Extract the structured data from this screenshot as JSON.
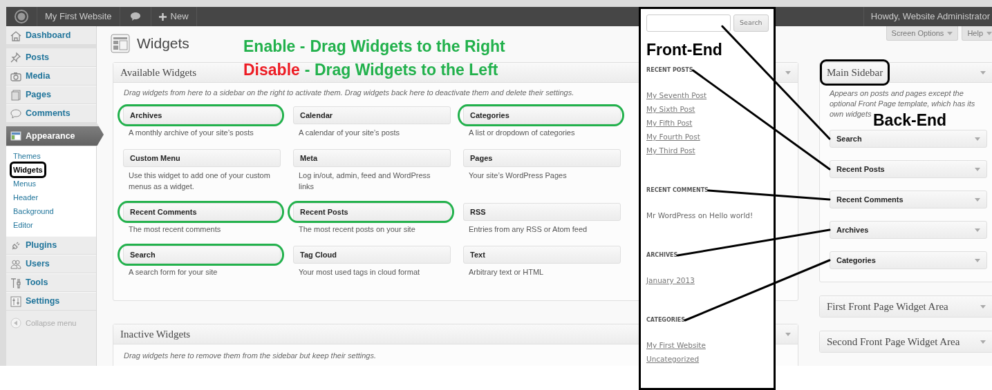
{
  "admin_bar": {
    "site_name": "My First Website",
    "new_label": "New",
    "greeting": "Howdy, Website Administrator"
  },
  "menu": [
    {
      "label": "Dashboard",
      "selected": false,
      "group_start": false
    },
    {
      "label": "Posts",
      "selected": false,
      "group_start": true
    },
    {
      "label": "Media",
      "selected": false,
      "group_start": false
    },
    {
      "label": "Pages",
      "selected": false,
      "group_start": false
    },
    {
      "label": "Comments",
      "selected": false,
      "group_start": false
    },
    {
      "label": "Appearance",
      "selected": true,
      "group_start": true,
      "submenu": [
        {
          "label": "Themes",
          "selected": false,
          "circled": false
        },
        {
          "label": "Widgets",
          "selected": true,
          "circled": true
        },
        {
          "label": "Menus",
          "selected": false,
          "circled": false
        },
        {
          "label": "Header",
          "selected": false,
          "circled": false
        },
        {
          "label": "Background",
          "selected": false,
          "circled": false
        },
        {
          "label": "Editor",
          "selected": false,
          "circled": false
        }
      ]
    },
    {
      "label": "Plugins",
      "selected": false,
      "group_start": false
    },
    {
      "label": "Users",
      "selected": false,
      "group_start": false
    },
    {
      "label": "Tools",
      "selected": false,
      "group_start": false
    },
    {
      "label": "Settings",
      "selected": false,
      "group_start": false
    }
  ],
  "collapse_label": "Collapse menu",
  "screen_options": "Screen Options",
  "help": "Help",
  "page_title": "Widgets",
  "callouts": [
    {
      "parts": [
        {
          "text": "Enable -",
          "color": "#22b14c"
        },
        {
          "text": "Drag Widgets to the Right",
          "color": "#22b14c"
        }
      ]
    },
    {
      "parts": [
        {
          "text": "Disable",
          "color": "#ed1c24"
        },
        {
          "text": "- Drag Widgets to the Left",
          "color": "#22b14c"
        }
      ]
    }
  ],
  "available": {
    "title": "Available Widgets",
    "description": "Drag widgets from here to a sidebar on the right to activate them. Drag widgets back here to deactivate them and delete their settings.",
    "widgets": [
      {
        "title": "Archives",
        "description": "A monthly archive of your site’s posts",
        "circled": true
      },
      {
        "title": "Calendar",
        "description": "A calendar of your site’s posts",
        "circled": false
      },
      {
        "title": "Categories",
        "description": "A list or dropdown of categories",
        "circled": true
      },
      {
        "title": "Custom Menu",
        "description": "Use this widget to add one of your custom menus as a widget.",
        "circled": false
      },
      {
        "title": "Meta",
        "description": "Log in/out, admin, feed and WordPress links",
        "circled": false
      },
      {
        "title": "Pages",
        "description": "Your site’s WordPress Pages",
        "circled": false
      },
      {
        "title": "Recent Comments",
        "description": "The most recent comments",
        "circled": true
      },
      {
        "title": "Recent Posts",
        "description": "The most recent posts on your site",
        "circled": true
      },
      {
        "title": "RSS",
        "description": "Entries from any RSS or Atom feed",
        "circled": false
      },
      {
        "title": "Search",
        "description": "A search form for your site",
        "circled": true
      },
      {
        "title": "Tag Cloud",
        "description": "Your most used tags in cloud format",
        "circled": false
      },
      {
        "title": "Text",
        "description": "Arbitrary text or HTML",
        "circled": false
      }
    ]
  },
  "inactive": {
    "title": "Inactive Widgets",
    "description": "Drag widgets here to remove them from the sidebar but keep their settings."
  },
  "main_sidebar": {
    "title": "Main Sidebar",
    "circled": true,
    "description": "Appears on posts and pages except the optional Front Page template, which has its own widgets",
    "label": "Back-End",
    "widgets": [
      {
        "title": "Search",
        "linked": true
      },
      {
        "title": "Recent Posts",
        "linked": true
      },
      {
        "title": "Recent Comments",
        "linked": true
      },
      {
        "title": "Archives",
        "linked": true
      },
      {
        "title": "Categories",
        "linked": true
      }
    ]
  },
  "other_areas": [
    {
      "title": "First Front Page Widget Area"
    },
    {
      "title": "Second Front Page Widget Area"
    }
  ],
  "front_end": {
    "search_button": "Search",
    "label": "Front-End",
    "sections": [
      {
        "kind": "links",
        "heading": "RECENT POSTS",
        "links": [
          "My Seventh Post",
          "My Sixth Post",
          "My Fifth Post",
          "My Fourth Post",
          "My Third Post"
        ]
      },
      {
        "kind": "comments",
        "heading": "RECENT COMMENTS",
        "comments": [
          {
            "author": "Mr WordPress",
            "joiner": "on",
            "post": "Hello world!"
          }
        ]
      },
      {
        "kind": "links",
        "heading": "ARCHIVES",
        "links": [
          "January 2013"
        ]
      },
      {
        "kind": "links",
        "heading": "CATEGORIES",
        "links": [
          "My First Website",
          "Uncategorized"
        ]
      }
    ]
  }
}
